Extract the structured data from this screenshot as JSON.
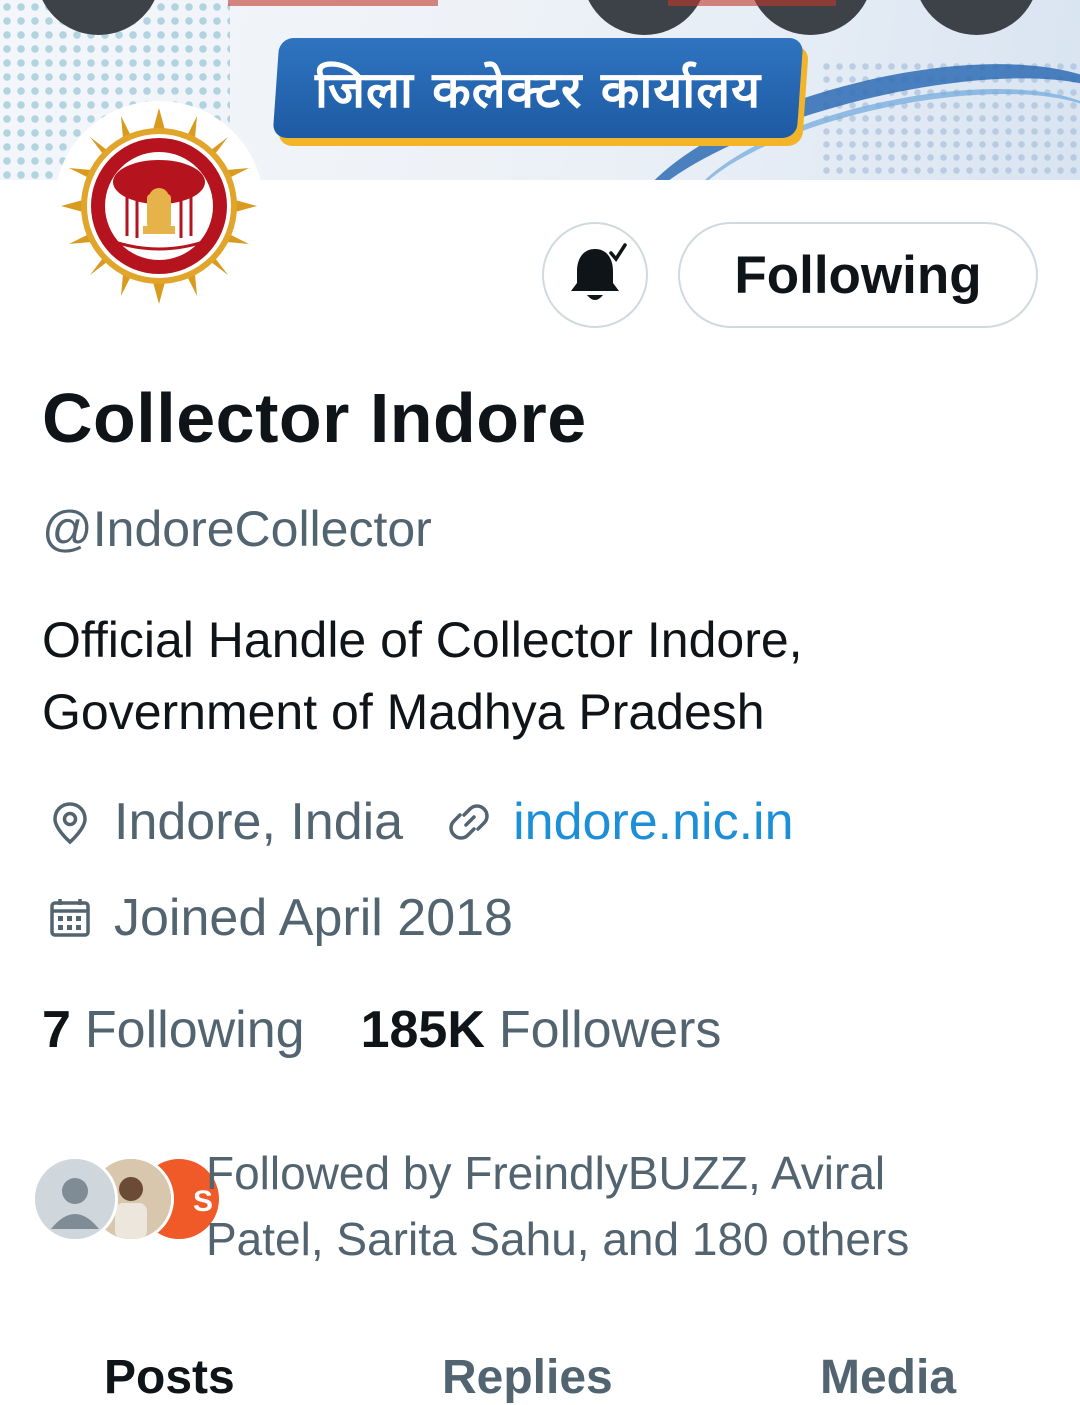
{
  "banner": {
    "title_hindi": "जिला कलेक्टर कार्यालय"
  },
  "profile": {
    "display_name": "Collector Indore",
    "handle": "@IndoreCollector",
    "bio_line1": "Official Handle of Collector Indore,",
    "bio_line2": "Government of Madhya Pradesh",
    "location": "Indore, India",
    "website": "indore.nic.in",
    "joined": "Joined April 2018"
  },
  "actions": {
    "notifications_icon": "bell-check-icon",
    "follow_label": "Following"
  },
  "stats": {
    "following_count": "7",
    "following_label": "Following",
    "followers_count": "185K",
    "followers_label": "Followers"
  },
  "followed_by": {
    "line1": "Followed by FreindlyBUZZ, Aviral",
    "line2": "Patel, Sarita Sahu, and 180 others"
  },
  "tabs": [
    {
      "label": "Posts",
      "active": true
    },
    {
      "label": "Replies",
      "active": false
    },
    {
      "label": "Media",
      "active": false
    }
  ],
  "colors": {
    "accent_link": "#1d8fd6",
    "text_primary": "#0f1419",
    "text_secondary": "#536471",
    "border": "#cfd9de",
    "banner_blue": "#1e5aa3",
    "banner_gold": "#f2b428",
    "seal_red": "#b5131d",
    "seal_gold": "#d89a1f"
  }
}
